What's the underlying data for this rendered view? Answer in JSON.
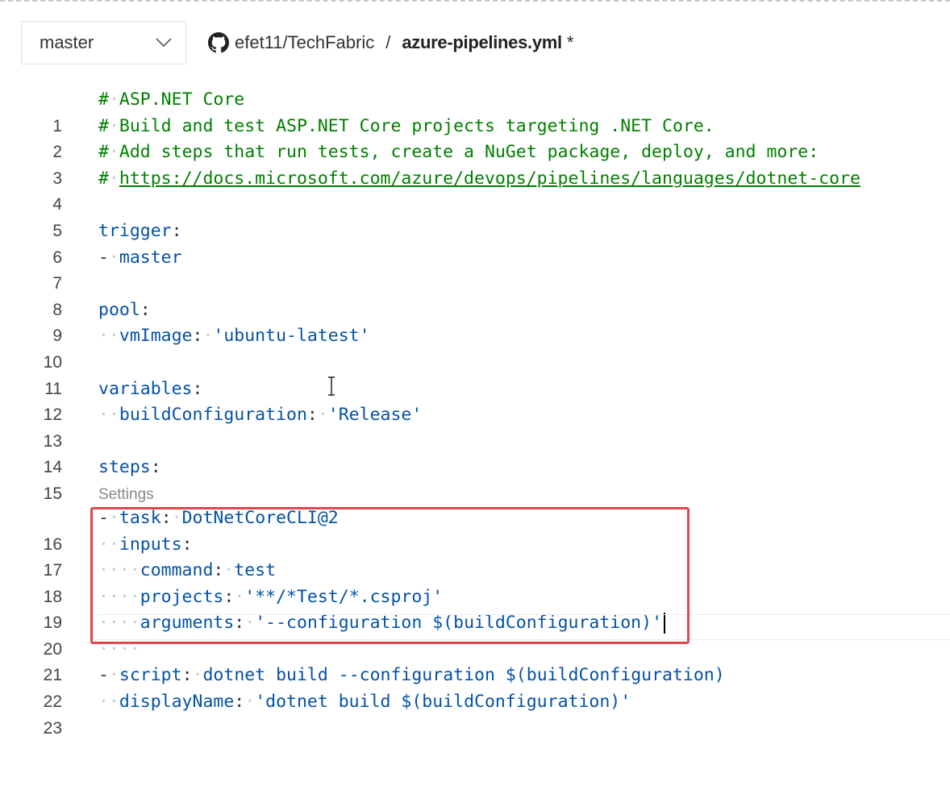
{
  "header": {
    "branch": "master",
    "repo": "efet11/TechFabric",
    "separator": "/",
    "filename": "azure-pipelines.yml",
    "modified_marker": "*"
  },
  "editor": {
    "codelens_label": "Settings",
    "line_numbers": [
      "1",
      "2",
      "3",
      "4",
      "5",
      "6",
      "7",
      "8",
      "9",
      "10",
      "11",
      "12",
      "13",
      "14",
      "15",
      "16",
      "17",
      "18",
      "19",
      "20",
      "21",
      "22",
      "23"
    ],
    "lines": {
      "l1_hash": "#",
      "l1_text": "ASP.NET Core",
      "l2_hash": "#",
      "l2_text": "Build and test ASP.NET Core projects targeting .NET Core.",
      "l3_hash": "#",
      "l3_text": "Add steps that run tests, create a NuGet package, deploy, and more:",
      "l4_hash": "#",
      "l4_link": "https://docs.microsoft.com/azure/devops/pipelines/languages/dotnet-core",
      "l6_key": "trigger",
      "l7_dash": "-",
      "l7_val": "master",
      "l9_key": "pool",
      "l10_key": "vmImage",
      "l10_val": "'ubuntu-latest'",
      "l12_key": "variables",
      "l13_key": "buildConfiguration",
      "l13_val": "'Release'",
      "l15_key": "steps",
      "l16_dash": "-",
      "l16_key": "task",
      "l16_val": "DotNetCoreCLI@2",
      "l17_key": "inputs",
      "l18_key": "command",
      "l18_val": "test",
      "l19_key": "projects",
      "l19_val": "'**/*Test/*.csproj'",
      "l20_key": "arguments",
      "l20_val": "'--configuration $(buildConfiguration)'",
      "l22_dash": "-",
      "l22_key": "script",
      "l22_val": "dotnet build --configuration $(buildConfiguration)",
      "l23_key": "displayName",
      "l23_val": "'dotnet build $(buildConfiguration)'"
    }
  },
  "colors": {
    "comment": "#008000",
    "key": "#0451a5",
    "highlight_box": "#e0474c",
    "whitespace_marker": "#c9c9c9"
  },
  "icons": {
    "branch_dropdown": "chevron-down-icon",
    "repo": "github-icon"
  }
}
